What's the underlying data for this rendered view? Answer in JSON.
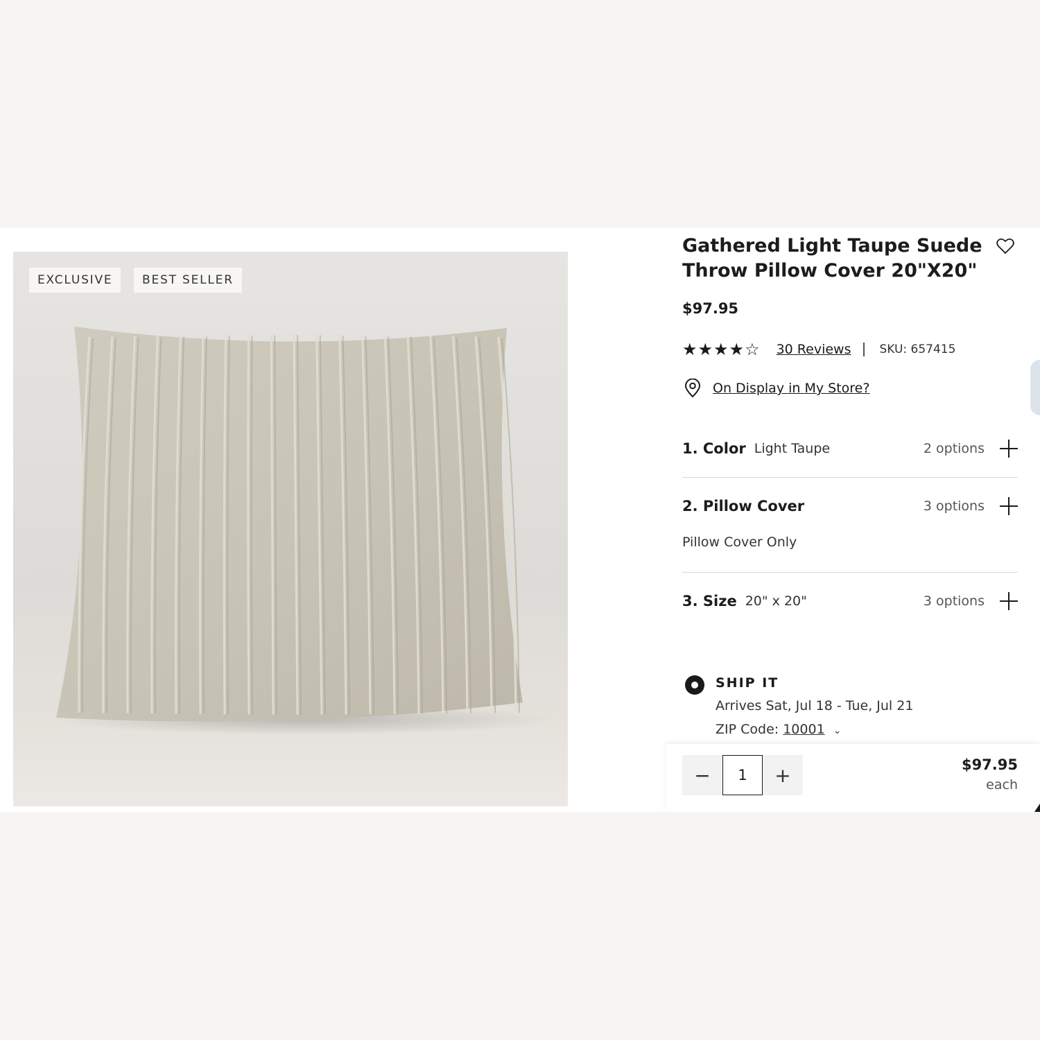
{
  "badges": [
    "EXCLUSIVE",
    "BEST SELLER"
  ],
  "product": {
    "title": "Gathered Light Taupe Suede Throw Pillow Cover 20\"X20\"",
    "price": "$97.95",
    "rating": 4,
    "rating_max": 5,
    "reviews_label": "30 Reviews",
    "sku": "SKU: 657415",
    "display_link": "On Display in My Store?"
  },
  "options": [
    {
      "label": "1. Color",
      "value": "Light Taupe",
      "count": "2 options"
    },
    {
      "label": "2. Pillow Cover",
      "value": "",
      "count": "3 options",
      "sub": "Pillow Cover Only"
    },
    {
      "label": "3. Size",
      "value": "20\" x 20\"",
      "count": "3 options"
    }
  ],
  "shipping": {
    "title": "SHIP IT",
    "arrives": "Arrives Sat, Jul 18 - Tue, Jul 21",
    "zip_label": "ZIP Code:",
    "zip": "10001"
  },
  "cart": {
    "minus": "−",
    "quantity": "1",
    "plus": "+",
    "price": "$97.95",
    "unit": "each"
  },
  "icons": {
    "wishlist": "heart-outline-icon",
    "location": "map-pin-icon",
    "star_full": "★",
    "star_empty": "☆",
    "expand": "plus-icon",
    "chevron": "⌄"
  },
  "colors": {
    "page_bg": "#f7f4f1",
    "panel_bg": "#ffffff",
    "text": "#1a1a1a",
    "pillow": "#c9c5b8"
  }
}
